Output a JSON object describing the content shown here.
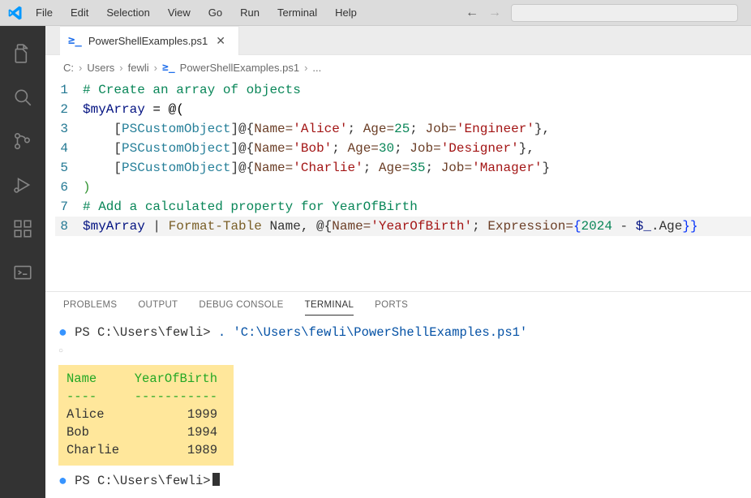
{
  "menu": [
    "File",
    "Edit",
    "Selection",
    "View",
    "Go",
    "Run",
    "Terminal",
    "Help"
  ],
  "tab": {
    "label": "PowerShellExamples.ps1"
  },
  "breadcrumb": [
    "C:",
    "Users",
    "fewli",
    "PowerShellExamples.ps1",
    "..."
  ],
  "code": {
    "l1": "# Create an array of objects",
    "l2_a": "$myArray",
    "l2_b": " = @(",
    "l3_a": "    [",
    "l3_b": "PSCustomObject",
    "l3_c": "]@{",
    "l3_d": "Name=",
    "l3_e": "'Alice'",
    "l3_f": "; ",
    "l3_g": "Age=",
    "l3_h": "25",
    "l3_i": "; ",
    "l3_j": "Job=",
    "l3_k": "'Engineer'",
    "l3_l": "},",
    "l4_a": "    [",
    "l4_b": "PSCustomObject",
    "l4_c": "]@{",
    "l4_d": "Name=",
    "l4_e": "'Bob'",
    "l4_f": "; ",
    "l4_g": "Age=",
    "l4_h": "30",
    "l4_i": "; ",
    "l4_j": "Job=",
    "l4_k": "'Designer'",
    "l4_l": "},",
    "l5_a": "    [",
    "l5_b": "PSCustomObject",
    "l5_c": "]@{",
    "l5_d": "Name=",
    "l5_e": "'Charlie'",
    "l5_f": "; ",
    "l5_g": "Age=",
    "l5_h": "35",
    "l5_i": "; ",
    "l5_j": "Job=",
    "l5_k": "'Manager'",
    "l5_l": "}",
    "l6": ")",
    "l7": "# Add a calculated property for YearOfBirth",
    "l8_a": "$myArray",
    "l8_b": " | ",
    "l8_c": "Format-Table",
    "l8_d": " Name, @{",
    "l8_e": "Name=",
    "l8_f": "'YearOfBirth'",
    "l8_g": "; ",
    "l8_h": "Expression=",
    "l8_i": "{",
    "l8_j": "2024",
    "l8_k": " - ",
    "l8_l": "$_",
    "l8_m": ".Age",
    "l8_n": "}}"
  },
  "ln": {
    "1": "1",
    "2": "2",
    "3": "3",
    "4": "4",
    "5": "5",
    "6": "6",
    "7": "7",
    "8": "8"
  },
  "panel_tabs": {
    "problems": "PROBLEMS",
    "output": "OUTPUT",
    "debug": "DEBUG CONSOLE",
    "terminal": "TERMINAL",
    "ports": "PORTS"
  },
  "term": {
    "prompt1": "PS C:\\Users\\fewli> ",
    "cmd1": ". 'C:\\Users\\fewli\\PowerShellExamples.ps1'",
    "prompt2": "PS C:\\Users\\fewli>",
    "table": "Name     YearOfBirth\n----     -----------\nAlice           1999\nBob             1994\nCharlie         1989",
    "table_hdr": "Name     YearOfBirth",
    "table_sep": "----     -----------",
    "row1": "Alice           1999",
    "row2": "Bob             1994",
    "row3": "Charlie         1989"
  }
}
